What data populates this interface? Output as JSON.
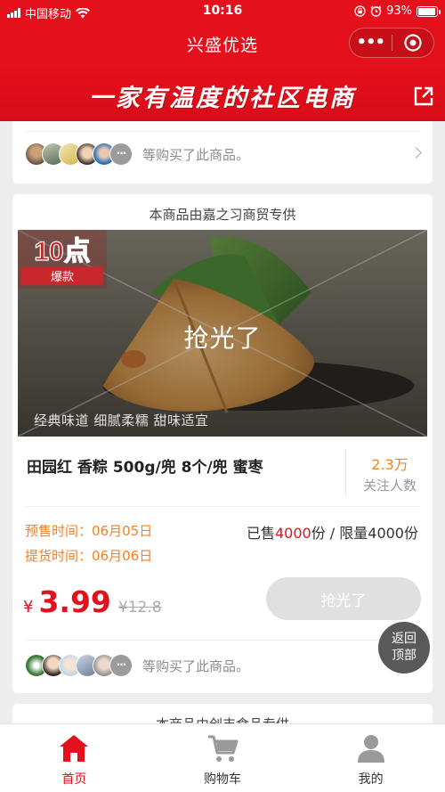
{
  "status_bar": {
    "carrier": "中国移动",
    "time": "10:16",
    "battery": "93%",
    "battery_level": 0.93
  },
  "header": {
    "title": "兴盛优选",
    "menu_label": "•••",
    "slogan": "一家有温度的社区电商"
  },
  "card_prev": {
    "buyers_text": "等购买了此商品。",
    "more_avatars": "···"
  },
  "product": {
    "supplier": "本商品由嘉之习商贸专供",
    "image_overlay": "抢光了",
    "image_badge_top": "10点",
    "image_badge_bottom": "爆款",
    "image_tagline": "经典味道 细腻柔糯 甜味适宜",
    "name": "田园红 香粽 500g/兜 8个/兜 蜜枣",
    "followers": "2.3万",
    "followers_label": "关注人数",
    "presale_label": "预售时间：",
    "presale_date": "06月05日",
    "pickup_label": "提货时间：",
    "pickup_date": "06月06日",
    "sold_prefix": "已售",
    "sold_count": "4000",
    "sold_suffix": "份 / 限量4000份",
    "currency": "¥",
    "price": "3.99",
    "old_price": "¥12.8",
    "buy_button": "抢光了",
    "buyers_text": "等购买了此商品。",
    "more_avatars": "···"
  },
  "next_card": {
    "supplier": "本商品由创丰食品专供"
  },
  "back_to_top": {
    "line1": "返回",
    "line2": "顶部"
  },
  "tabs": [
    {
      "label": "首页",
      "icon": "home-icon",
      "active": true
    },
    {
      "label": "购物车",
      "icon": "cart-icon",
      "active": false
    },
    {
      "label": "我的",
      "icon": "user-icon",
      "active": false
    }
  ],
  "colors": {
    "brand_red": "#e4101b",
    "accent_orange": "#f08228",
    "disabled_button": "#e0e0e0"
  }
}
